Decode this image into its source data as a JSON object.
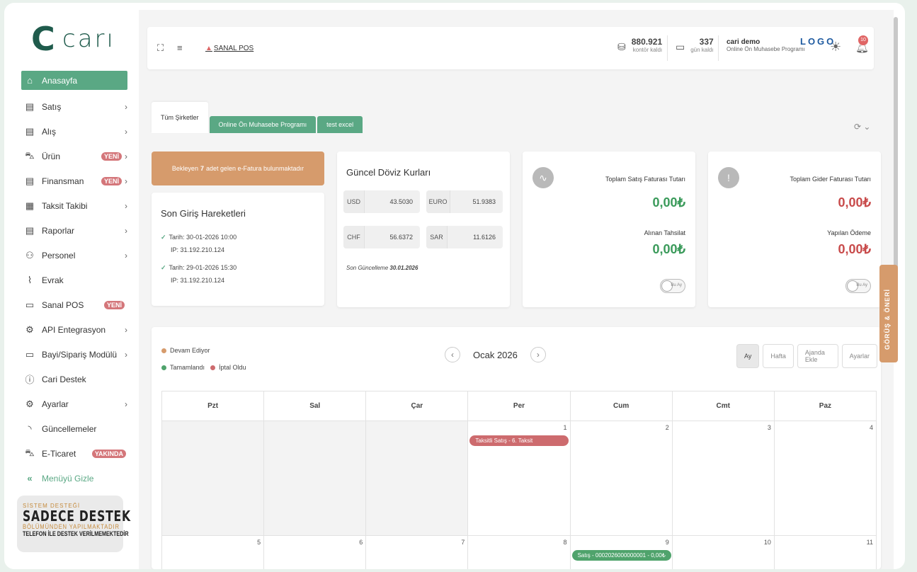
{
  "sidebar": {
    "logo_text": "carı",
    "items": [
      {
        "label": "Anasayfa"
      },
      {
        "label": "Satış"
      },
      {
        "label": "Alış"
      },
      {
        "label": "Ürün",
        "badge": "YENİ"
      },
      {
        "label": "Finansman",
        "badge": "YENİ"
      },
      {
        "label": "Taksit Takibi"
      },
      {
        "label": "Raporlar"
      },
      {
        "label": "Personel"
      },
      {
        "label": "Evrak"
      },
      {
        "label": "Sanal POS",
        "badge": "YENİ"
      },
      {
        "label": "API Entegrasyon"
      },
      {
        "label": "Bayi/Sipariş Modülü"
      },
      {
        "label": "Cari Destek"
      },
      {
        "label": "Ayarlar"
      },
      {
        "label": "Güncellemeler"
      },
      {
        "label": "E-Ticaret",
        "badge": "YAKINDA"
      },
      {
        "label": "Menüyü Gizle"
      }
    ],
    "support": {
      "line1": "SİSTEM DESTEĞİ",
      "line2": "SADECE DESTEK",
      "line3": "BÖLÜMÜNDEN YAPILMAKTADIR",
      "line4": "TELEFON İLE DESTEK VERİLMEMEKTEDİR"
    }
  },
  "topbar": {
    "sanal_pos": "SANAL POS",
    "kontor": {
      "value": "880.921",
      "label": "kontör kaldı"
    },
    "gun": {
      "value": "337",
      "label": "gün kaldı"
    },
    "user": {
      "name": "cari demo",
      "desc": "Online Ön Muhasebe Programı"
    },
    "brand_logo": "LOGO",
    "notification_count": "10"
  },
  "tabs": [
    "Tüm Şirketler",
    "Online Ön Muhasebe Programı",
    "test excel"
  ],
  "efatura": {
    "prefix": "Bekleyen",
    "count": "7",
    "suffix": "adet gelen e-Fatura bulunmaktadır"
  },
  "login": {
    "title": "Son Giriş Hareketleri",
    "entries": [
      {
        "date": "Tarih: 30-01-2026 10:00",
        "ip": "IP: 31.192.210.124"
      },
      {
        "date": "Tarih: 29-01-2026 15:30",
        "ip": "IP: 31.192.210.124"
      }
    ]
  },
  "fx": {
    "title": "Güncel Döviz Kurları",
    "rates": [
      {
        "code": "USD",
        "value": "43.5030"
      },
      {
        "code": "EURO",
        "value": "51.9383"
      },
      {
        "code": "CHF",
        "value": "56.6372"
      },
      {
        "code": "SAR",
        "value": "11.6126"
      }
    ],
    "updated_label": "Son Güncelleme",
    "updated_date": "30.01.2026"
  },
  "sales": {
    "title": "Toplam Satış Faturası Tutarı",
    "amount": "0,00₺",
    "sub_title": "Alınan Tahsilat",
    "sub_amount": "0,00₺",
    "toggle": "Bu Ay"
  },
  "expense": {
    "title": "Toplam Gider Faturası Tutarı",
    "amount": "0,00₺",
    "sub_title": "Yapılan Ödeme",
    "sub_amount": "0,00₺",
    "toggle": "Bu Ay"
  },
  "feedback": "GÖRÜŞ & ÖNERİ",
  "calendar": {
    "legend": {
      "ongoing": "Devam Ediyor",
      "done": "Tamamlandı",
      "cancelled": "İptal Oldu"
    },
    "month": "Ocak 2026",
    "views": [
      "Ay",
      "Hafta",
      "Ajanda Ekle",
      "Ayarlar"
    ],
    "days": [
      "Pzt",
      "Sal",
      "Çar",
      "Per",
      "Cum",
      "Cmt",
      "Paz"
    ],
    "week1": [
      "",
      "",
      "",
      "1",
      "2",
      "3",
      "4"
    ],
    "week2": [
      "5",
      "6",
      "7",
      "8",
      "9",
      "10",
      "11"
    ],
    "event1": "Taksitli Satış - 6. Taksit",
    "event2": "Satış - 0002026000000001 - 0,00₺"
  },
  "colors": {
    "brand": "#1f5b4c",
    "accent": "#5aa884",
    "warning": "#d69b6c",
    "danger": "#c84b4b"
  }
}
